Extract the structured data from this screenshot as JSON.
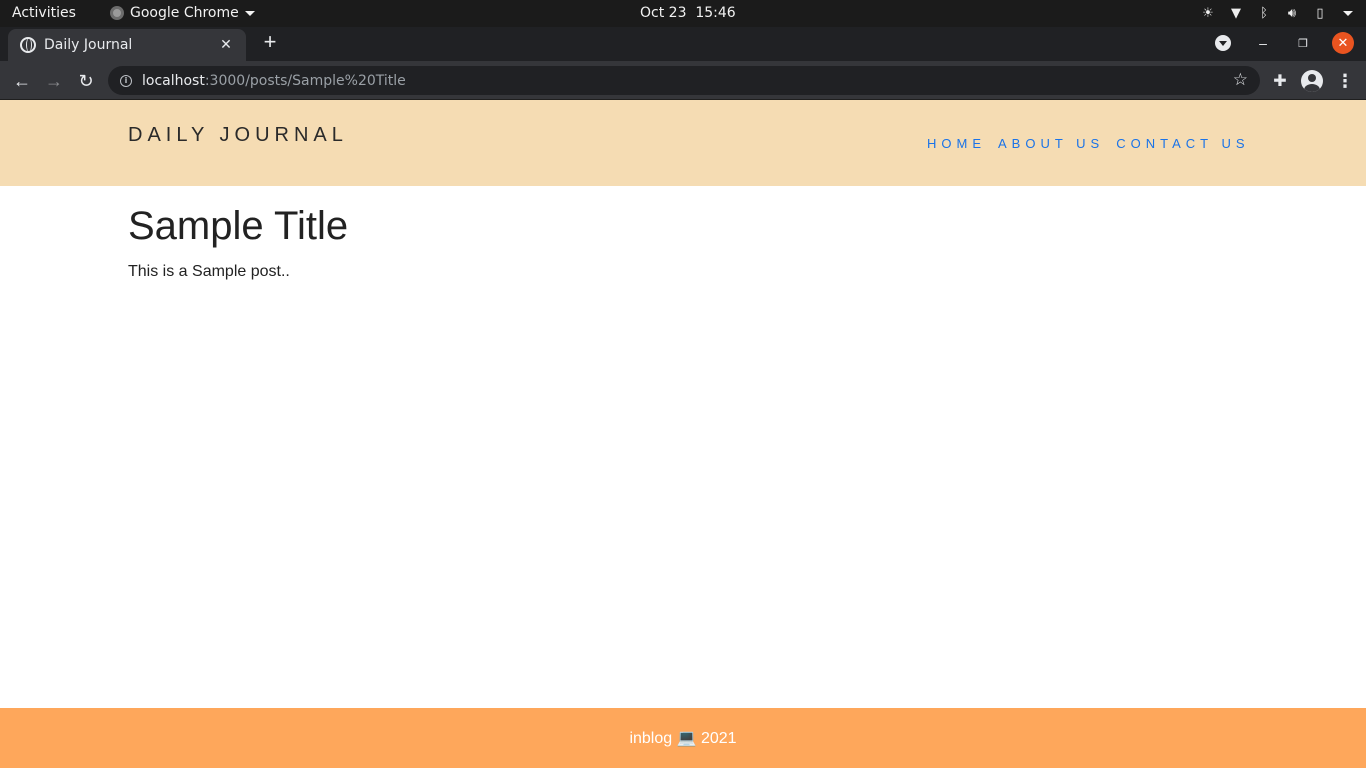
{
  "os": {
    "activities": "Activities",
    "app_name": "Google Chrome",
    "clock": "Oct 23  15:46"
  },
  "browser": {
    "tab_title": "Daily Journal",
    "tab_close": "✕",
    "new_tab": "+",
    "url_host": "localhost",
    "url_path": ":3000/posts/Sample%20Title"
  },
  "site": {
    "brand": "DAILY JOURNAL",
    "nav": [
      "HOME",
      "ABOUT US",
      "CONTACT US"
    ]
  },
  "post": {
    "title": "Sample Title",
    "body": "This is a Sample post.."
  },
  "footer": {
    "text": "inblog 💻 2021"
  }
}
